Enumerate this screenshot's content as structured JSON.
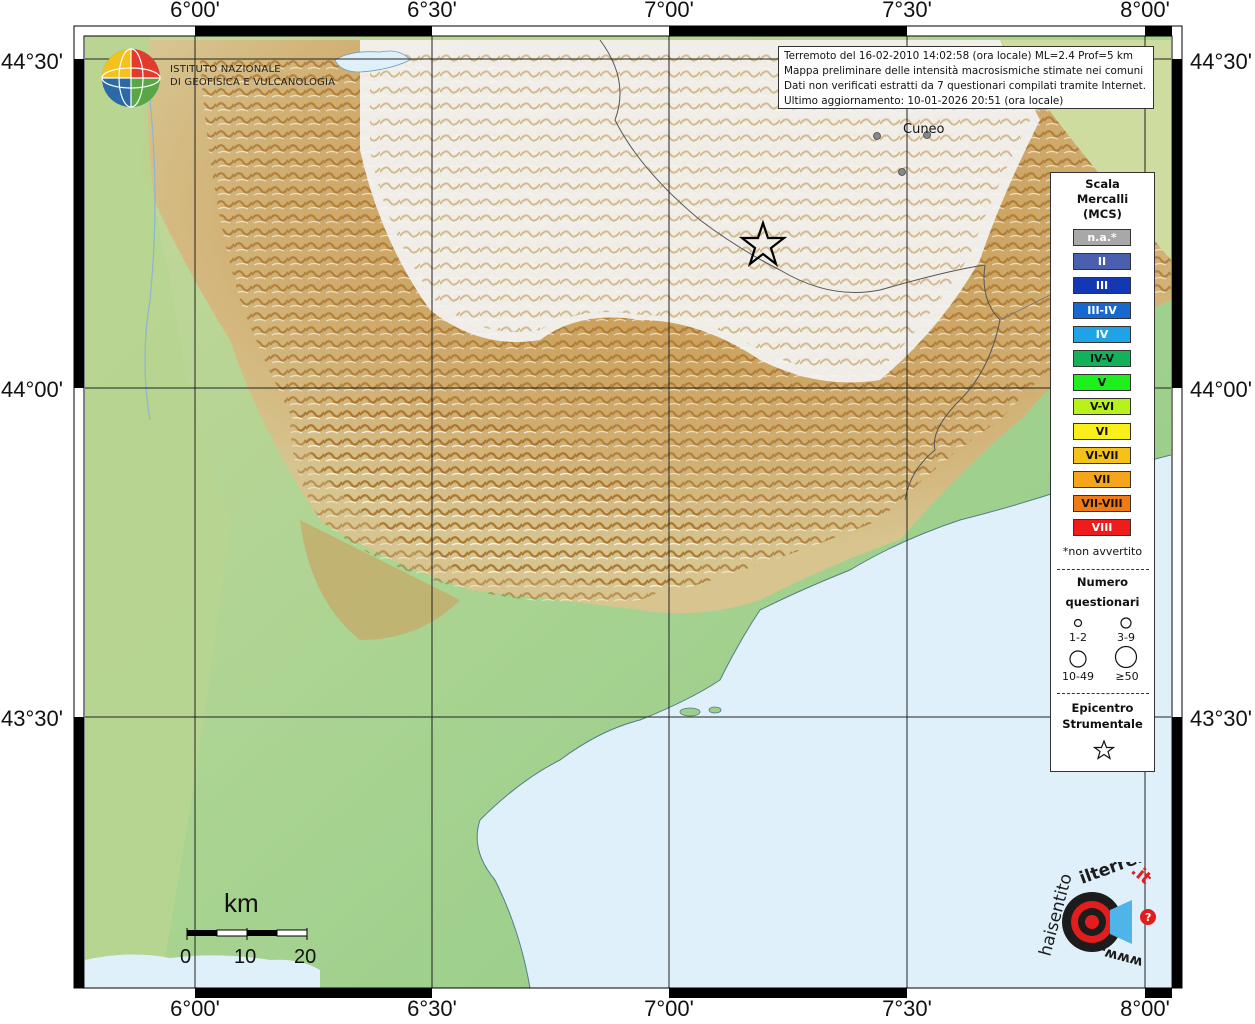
{
  "map": {
    "axes": {
      "longitudes": [
        "6°00'",
        "6°30'",
        "7°00'",
        "7°30'",
        "8°00'"
      ],
      "latitudes": [
        "44°30'",
        "44°00'",
        "43°30'"
      ]
    },
    "colors": {
      "sea": "#dff0fb",
      "lowland": "#9ecf8a",
      "hills": "#d8c98e",
      "mountains": "#b98a3e",
      "peaks": "#ffffff",
      "grid": "#222222",
      "border": "#555555"
    }
  },
  "info": {
    "line1": "Terremoto del 16-02-2010 14:02:58 (ora locale) ML=2.4 Prof=5 km",
    "line2": "Mappa preliminare delle intensità macrosismiche stimate nei comuni",
    "line3": "Dati non verificati estratti da 7 questionari compilati tramite Internet.",
    "line4": "Ultimo aggiornamento: 10-01-2026 20:51 (ora locale)"
  },
  "ingv": {
    "line1": "ISTITUTO NAZIONALE",
    "line2": "DI GEOFISICA E VULCANOLOGIA"
  },
  "city": "Cuneo",
  "legend": {
    "title1": "Scala",
    "title2": "Mercalli",
    "title3": "(MCS)",
    "levels": [
      {
        "label": "n.a.*",
        "color": "#a8a8a8",
        "text": "#ffffff"
      },
      {
        "label": "II",
        "color": "#4a5fb0",
        "text": "#ffffff"
      },
      {
        "label": "III",
        "color": "#1438b5",
        "text": "#ffffff"
      },
      {
        "label": "III-IV",
        "color": "#1868d2",
        "text": "#ffffff"
      },
      {
        "label": "IV",
        "color": "#1ea3e6",
        "text": "#ffffff"
      },
      {
        "label": "IV-V",
        "color": "#13b25a",
        "text": "#111111"
      },
      {
        "label": "V",
        "color": "#1df01d",
        "text": "#111111"
      },
      {
        "label": "V-VI",
        "color": "#b7f21a",
        "text": "#111111"
      },
      {
        "label": "VI",
        "color": "#f9f01a",
        "text": "#111111"
      },
      {
        "label": "VI-VII",
        "color": "#f5c21a",
        "text": "#111111"
      },
      {
        "label": "VII",
        "color": "#f5a51a",
        "text": "#111111"
      },
      {
        "label": "VII-VIII",
        "color": "#f07a14",
        "text": "#111111"
      },
      {
        "label": "VIII",
        "color": "#ee1c1c",
        "text": "#ffffff"
      }
    ],
    "not_felt": "*non avvertito",
    "count_title1": "Numero",
    "count_title2": "questionari",
    "counts": [
      "1-2",
      "3-9",
      "10-49",
      "≥50"
    ],
    "epicenter1": "Epicentro",
    "epicenter2": "Strumentale"
  },
  "scalebar": {
    "unit": "km",
    "ticks": [
      "0",
      "10",
      "20"
    ]
  },
  "site_logo": {
    "text1": "haisentito",
    "text2": "ilterremoto",
    "text3": ".it",
    "text4": "www."
  }
}
